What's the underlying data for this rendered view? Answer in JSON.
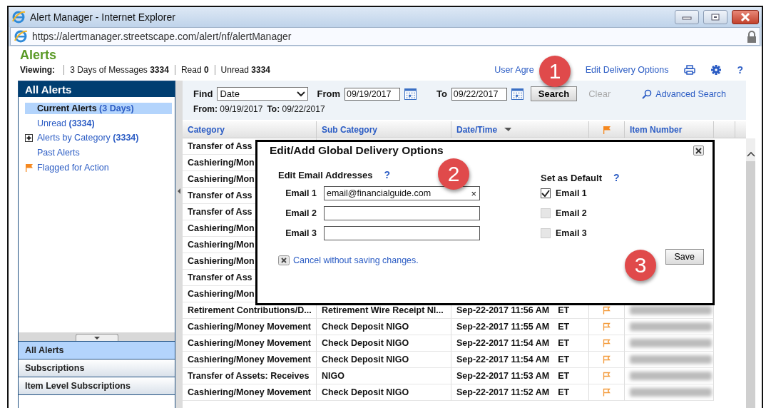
{
  "window": {
    "title": "Alert Manager - Internet Explorer",
    "url": "https://alertmanager.streetscape.com/alert/nf/alertManager"
  },
  "page": {
    "title": "Alerts",
    "viewing_label": "Viewing:",
    "viewing": [
      {
        "label": "3 Days of Messages",
        "count": "3334"
      },
      {
        "label": "Read",
        "count": "0"
      },
      {
        "label": "Unread",
        "count": "3334"
      }
    ],
    "links": [
      "User Agre",
      "Edit Delivery Options"
    ],
    "help": "?"
  },
  "sidebar": {
    "title": "All Alerts",
    "items": [
      {
        "label": "Current Alerts",
        "count": "(3 Days)",
        "selected": true,
        "kind": "plain"
      },
      {
        "label": "Unread",
        "count": "(3334)",
        "selected": false,
        "kind": "plain"
      },
      {
        "label": "Alerts by Category",
        "count": "(3334)",
        "selected": false,
        "kind": "expandable"
      },
      {
        "label": "Past Alerts",
        "selected": false,
        "kind": "plain"
      },
      {
        "label": "Flagged for Action",
        "selected": false,
        "kind": "flagged"
      }
    ],
    "tabs": [
      {
        "label": "All Alerts",
        "selected": true
      },
      {
        "label": "Subscriptions",
        "selected": false
      },
      {
        "label": "Item Level Subscriptions",
        "selected": false
      }
    ]
  },
  "search": {
    "find_label": "Find",
    "find_value": "Date",
    "from_label": "From",
    "from_value": "09/19/2017",
    "to_label": "To",
    "to_value": "09/22/2017",
    "search_button": "Search",
    "clear_button": "Clear",
    "advanced": "Advanced Search",
    "range": [
      {
        "label": "From:",
        "value": "09/19/2017"
      },
      {
        "label": "To:",
        "value": "09/22/2017"
      }
    ]
  },
  "table": {
    "columns": [
      {
        "kind": "text",
        "label": "Category"
      },
      {
        "kind": "text",
        "label": "Sub Category"
      },
      {
        "kind": "sort",
        "label": "Date/Time"
      },
      {
        "kind": "flag"
      },
      {
        "kind": "text",
        "label": "Item Number"
      }
    ],
    "rows": [
      {
        "kind": "covered",
        "category": "Transfer of Ass"
      },
      {
        "kind": "covered",
        "category": "Cashiering/Mon"
      },
      {
        "kind": "covered",
        "category": "Cashiering/Mon"
      },
      {
        "kind": "covered",
        "category": "Transfer of Ass"
      },
      {
        "kind": "covered",
        "category": "Transfer of Ass"
      },
      {
        "kind": "covered",
        "category": "Cashiering/Mon"
      },
      {
        "kind": "covered",
        "category": "Cashiering/Mon"
      },
      {
        "kind": "covered",
        "category": "Cashiering/Mon"
      },
      {
        "kind": "covered",
        "category": "Transfer of Ass"
      },
      {
        "kind": "covered",
        "category": "Cashiering/Mon"
      },
      {
        "kind": "full",
        "category": "Retirement Contributions/D...",
        "sub_category": "Retirement Wire Receipt NI...",
        "date": "Sep-22-2017 11:56 AM",
        "zone": "ET"
      },
      {
        "kind": "full",
        "category": "Cashiering/Money Movement",
        "sub_category": "Check Deposit NIGO",
        "date": "Sep-22-2017 11:55 AM",
        "zone": "ET"
      },
      {
        "kind": "full",
        "category": "Cashiering/Money Movement",
        "sub_category": "Check Deposit NIGO",
        "date": "Sep-22-2017 11:54 AM",
        "zone": "ET"
      },
      {
        "kind": "full",
        "category": "Cashiering/Money Movement",
        "sub_category": "Check Deposit NIGO",
        "date": "Sep-22-2017 11:54 AM",
        "zone": "ET"
      },
      {
        "kind": "full",
        "category": "Transfer of Assets: Receives",
        "sub_category": "NIGO",
        "date": "Sep-22-2017 11:53 AM",
        "zone": "ET"
      },
      {
        "kind": "full",
        "category": "Cashiering/Money Movement",
        "sub_category": "Check Deposit NIGO",
        "date": "Sep-22-2017 11:52 AM",
        "zone": "ET"
      }
    ]
  },
  "dialog": {
    "title": "Edit/Add Global Delivery Options",
    "emails_heading": "Edit Email Addresses",
    "help": "?",
    "emails": [
      {
        "label": "Email 1",
        "value": "email@financialguide.com",
        "clear": "×"
      },
      {
        "label": "Email 2"
      },
      {
        "label": "Email 3"
      }
    ],
    "default_heading": "Set as Default",
    "default_help": "?",
    "defaults": [
      {
        "label": "Email 1",
        "checked": true,
        "disabled": false
      },
      {
        "label": "Email 2",
        "checked": false,
        "disabled": true
      },
      {
        "label": "Email 3",
        "checked": false,
        "disabled": true
      }
    ],
    "cancel": "Cancel without saving changes.",
    "save": "Save"
  },
  "annotations": [
    "1",
    "2",
    "3"
  ]
}
